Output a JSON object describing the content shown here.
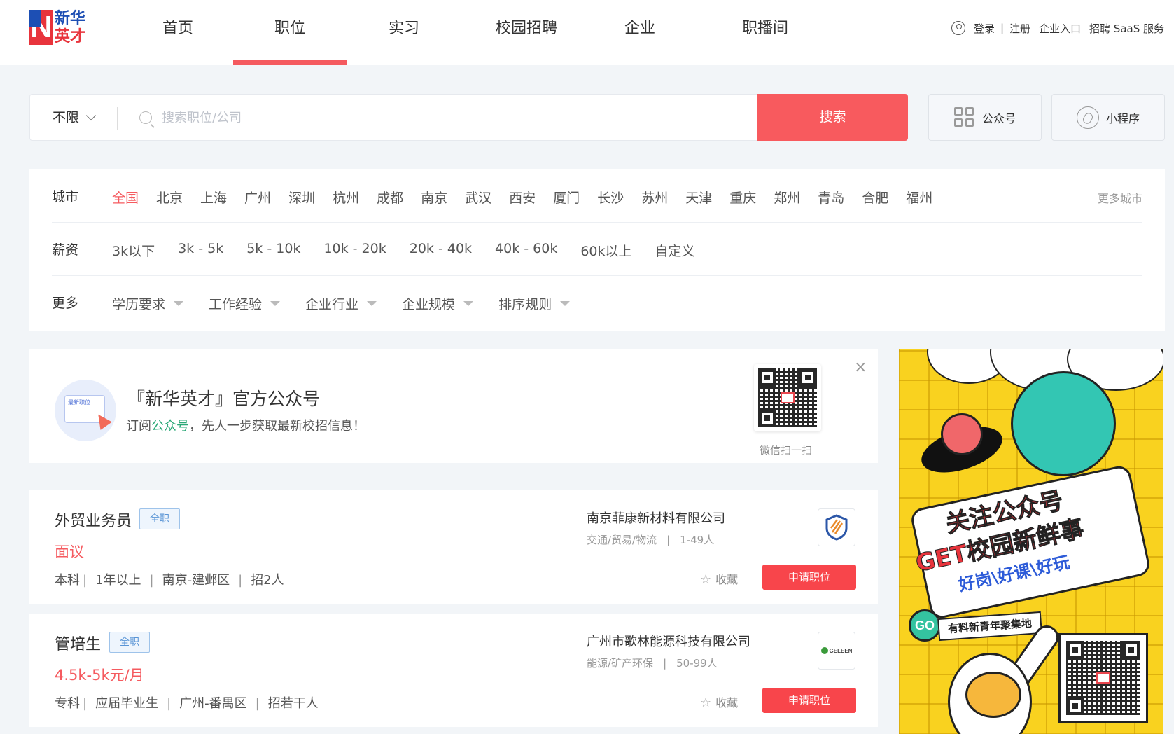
{
  "header": {
    "logo_lines": [
      "新华",
      "英才"
    ],
    "logo_letter": "N",
    "nav": [
      {
        "label": "首页",
        "active": false
      },
      {
        "label": "职位",
        "active": true
      },
      {
        "label": "实习",
        "active": false
      },
      {
        "label": "校园招聘",
        "active": false
      },
      {
        "label": "企业",
        "active": false
      },
      {
        "label": "职播间",
        "active": false
      }
    ],
    "login": "登录",
    "sep": "|",
    "register": "注册",
    "enterprise_entry": "企业入口",
    "saas": "招聘 SaaS 服务"
  },
  "search": {
    "city_value": "不限",
    "placeholder": "搜索职位/公司",
    "button": "搜索",
    "wechat_button": "公众号",
    "miniprogram_button": "小程序"
  },
  "filters": {
    "city": {
      "label": "城市",
      "options": [
        "全国",
        "北京",
        "上海",
        "广州",
        "深圳",
        "杭州",
        "成都",
        "南京",
        "武汉",
        "西安",
        "厦门",
        "长沙",
        "苏州",
        "天津",
        "重庆",
        "郑州",
        "青岛",
        "合肥",
        "福州"
      ],
      "selected": "全国",
      "more": "更多城市"
    },
    "salary": {
      "label": "薪资",
      "options": [
        "3k以下",
        "3k - 5k",
        "5k - 10k",
        "10k - 20k",
        "20k - 40k",
        "40k - 60k",
        "60k以上",
        "自定义"
      ]
    },
    "more": {
      "label": "更多",
      "dropdowns": [
        "学历要求",
        "工作经验",
        "企业行业",
        "企业规模",
        "排序规则"
      ]
    }
  },
  "promo": {
    "title": "『新华英才』官方公众号",
    "desc_prefix": "订阅",
    "desc_highlight": "公众号",
    "desc_suffix": "，先人一步获取最新校招信息！",
    "card_text": "最新职位",
    "qr_caption": "微信扫一扫",
    "close": "×"
  },
  "jobs": [
    {
      "title": "外贸业务员",
      "tag": "全职",
      "salary": "面议",
      "education": "本科",
      "experience": "1年以上",
      "location": "南京-建邺区",
      "headcount": "招2人",
      "company": "南京菲康新材料有限公司",
      "industry": "交通/贸易/物流",
      "size": "1-49人",
      "fav": "收藏",
      "apply": "申请职位"
    },
    {
      "title": "管培生",
      "tag": "全职",
      "salary": "4.5k-5k元/月",
      "education": "专科",
      "experience": "应届毕业生",
      "location": "广州-番禺区",
      "headcount": "招若干人",
      "company": "广州市歌林能源科技有限公司",
      "industry": "能源/矿产环保",
      "size": "50-99人",
      "logo_text": "GELEEN",
      "fav": "收藏",
      "apply": "申请职位"
    }
  ],
  "ad": {
    "line1": "关注公众号",
    "line2": "GET校园新鲜事",
    "line3": "好岗\\好课\\好玩",
    "go": "GO",
    "ribbon": "有料新青年聚集地"
  },
  "colors": {
    "accent": "#f55a5f",
    "tag_blue": "#5a95d6",
    "link_green": "#2aa877",
    "ad_yellow": "#f9d21f"
  }
}
